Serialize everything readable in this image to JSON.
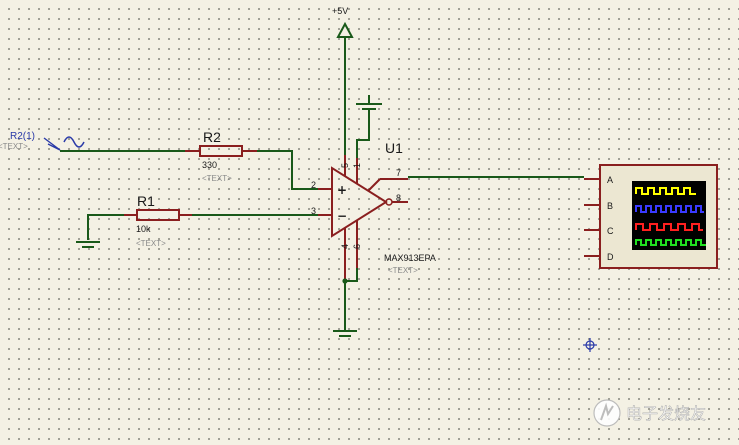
{
  "power": {
    "label": "+5V"
  },
  "source": {
    "ref": "R2(1)",
    "placeholder": "<TEXT>"
  },
  "r2": {
    "ref": "R2",
    "value": "330",
    "placeholder": "<TEXT>"
  },
  "r1": {
    "ref": "R1",
    "value": "10k",
    "placeholder": "<TEXT>"
  },
  "u1": {
    "ref": "U1",
    "part": "MAX913EPA",
    "placeholder": "<TEXT>",
    "plus_sign": "+",
    "minus_sign": "−",
    "pins": {
      "p5": "5",
      "p1": "1",
      "p2": "2",
      "p3": "3",
      "p4": "4",
      "p6": "6",
      "p7": "7",
      "p8": "8"
    }
  },
  "scope": {
    "channels": [
      "A",
      "B",
      "C",
      "D"
    ],
    "trace_colors": [
      "#ffff00",
      "#3a3aff",
      "#ff2020",
      "#20e020"
    ]
  },
  "watermark": {
    "text": "电子发烧友"
  }
}
